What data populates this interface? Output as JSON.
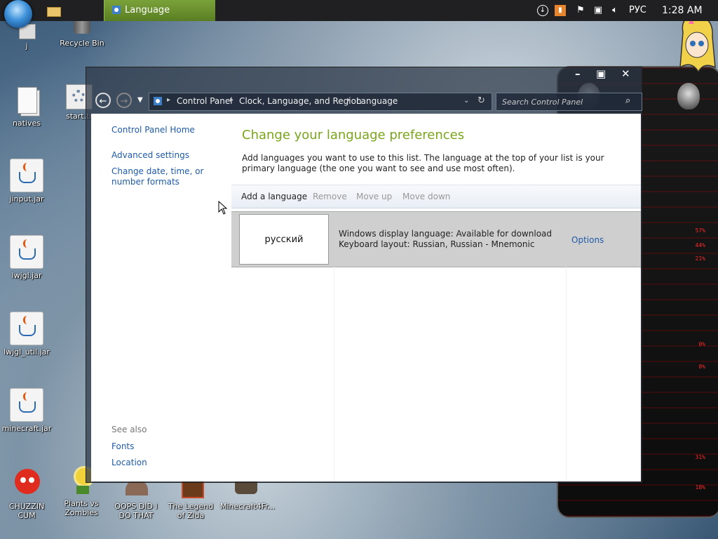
{
  "taskbar": {
    "task_title": "Language",
    "language_indicator": "РУС",
    "clock": "1:28 AM"
  },
  "desktop_icons": [
    {
      "label": "j"
    },
    {
      "label": "Recycle Bin"
    },
    {
      "label": "natives"
    },
    {
      "label": "start.b"
    },
    {
      "label": "jinput.jar"
    },
    {
      "label": "lwjgl.jar"
    },
    {
      "label": "lwjgl_util.jar"
    },
    {
      "label": "minecraft.jar"
    },
    {
      "label": "CHUZZIN CUM"
    },
    {
      "label": "Plants vs Zombies"
    },
    {
      "label": "OOPS DID I DO THAT"
    },
    {
      "label": "The Legend of Zlda"
    },
    {
      "label": "Minecraft4Fr..."
    }
  ],
  "breadcrumb": [
    "Control Panel",
    "Clock, Language, and Region",
    "Language"
  ],
  "search": {
    "placeholder": "Search Control Panel"
  },
  "left_nav": {
    "home": "Control Panel Home",
    "advanced": "Advanced settings",
    "change_date": "Change date, time, or number formats",
    "see_also": "See also",
    "fonts": "Fonts",
    "location": "Location"
  },
  "main": {
    "title": "Change your language preferences",
    "description": "Add languages you want to use to this list. The language at the top of your list is your primary language (the one you want to see and use most often).",
    "toolbar": {
      "add": "Add a language",
      "remove": "Remove",
      "move_up": "Move up",
      "move_down": "Move down"
    },
    "languages": [
      {
        "name": "русский",
        "display_language": "Windows display language: Available for download",
        "keyboard_layout": "Keyboard layout: Russian, Russian - Mnemonic",
        "options": "Options"
      }
    ]
  },
  "gadget": {
    "readouts": [
      "57%",
      "44%",
      "21%",
      "0%",
      "0%",
      "31%",
      "18%"
    ]
  },
  "colors": {
    "title_green": "#7aa51b",
    "link_blue": "#1e5aa8",
    "task_green": "#6a922f"
  }
}
